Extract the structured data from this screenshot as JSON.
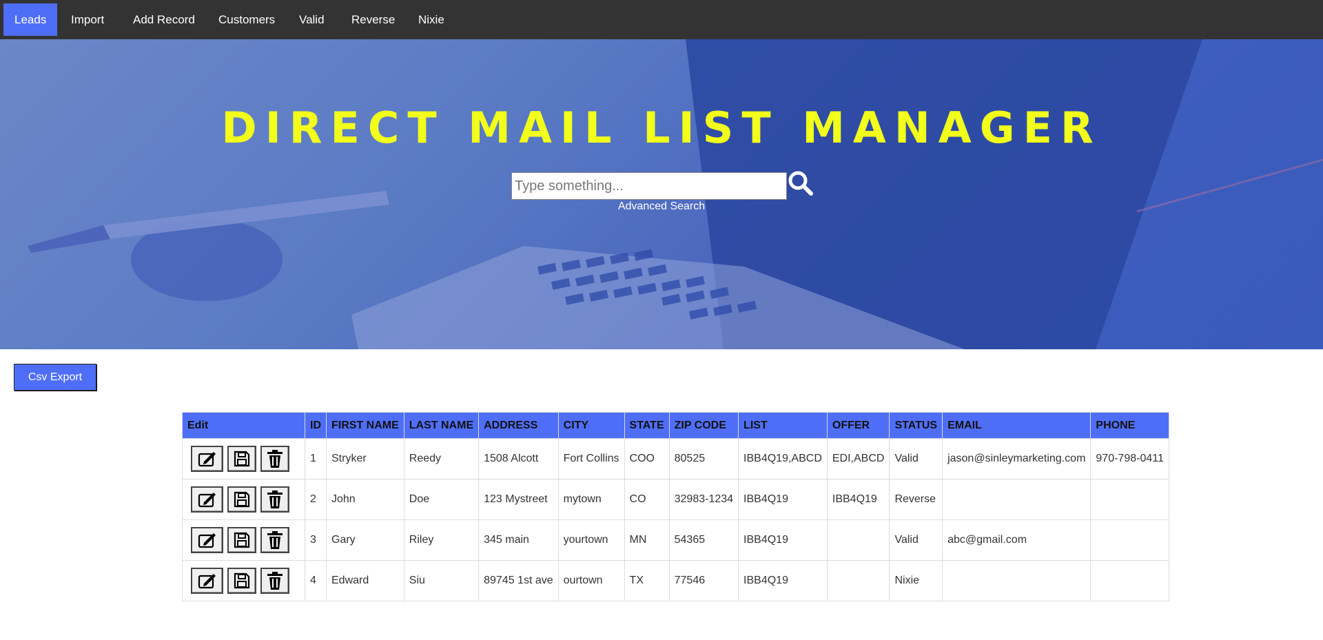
{
  "nav": {
    "items": [
      {
        "label": "Leads",
        "active": true
      },
      {
        "label": "Import"
      },
      {
        "label": "Add Record"
      },
      {
        "label": "Customers"
      },
      {
        "label": "Valid"
      },
      {
        "label": "Reverse"
      },
      {
        "label": "Nixie"
      }
    ]
  },
  "hero": {
    "title": "DIRECT MAIL LIST MANAGER",
    "search": {
      "placeholder": "Type something..."
    },
    "search_icon": "search-icon",
    "advanced_search_label": "Advanced Search"
  },
  "toolbar": {
    "csv_export_label": "Csv Export"
  },
  "table": {
    "headers": [
      "Edit",
      "ID",
      "FIRST NAME",
      "LAST NAME",
      "ADDRESS",
      "CITY",
      "STATE",
      "ZIP CODE",
      "LIST",
      "OFFER",
      "STATUS",
      "EMAIL",
      "PHONE"
    ],
    "row_icons": [
      "edit-icon",
      "save-icon",
      "trash-icon"
    ],
    "rows": [
      {
        "id": "1",
        "first": "Stryker",
        "last": "Reedy",
        "address": "1508 Alcott",
        "city": "Fort Collins",
        "state": "COO",
        "zip": "80525",
        "list": "IBB4Q19,ABCD",
        "offer": "EDI,ABCD",
        "status": "Valid",
        "email": "jason@sinleymarketing.com",
        "phone": "970-798-0411"
      },
      {
        "id": "2",
        "first": "John",
        "last": "Doe",
        "address": "123 Mystreet",
        "city": "mytown",
        "state": "CO",
        "zip": "32983-1234",
        "list": "IBB4Q19",
        "offer": "IBB4Q19",
        "status": "Reverse",
        "email": "",
        "phone": ""
      },
      {
        "id": "3",
        "first": "Gary",
        "last": "Riley",
        "address": "345 main",
        "city": "yourtown",
        "state": "MN",
        "zip": "54365",
        "list": "IBB4Q19",
        "offer": "",
        "status": "Valid",
        "email": "abc@gmail.com",
        "phone": ""
      },
      {
        "id": "4",
        "first": "Edward",
        "last": "Siu",
        "address": "89745 1st ave",
        "city": "ourtown",
        "state": "TX",
        "zip": "77546",
        "list": "IBB4Q19",
        "offer": "",
        "status": "Nixie",
        "email": "",
        "phone": ""
      }
    ]
  },
  "colors": {
    "accent": "#4f6ef7",
    "nav_bg": "#333333",
    "title": "#f2ff1a"
  }
}
